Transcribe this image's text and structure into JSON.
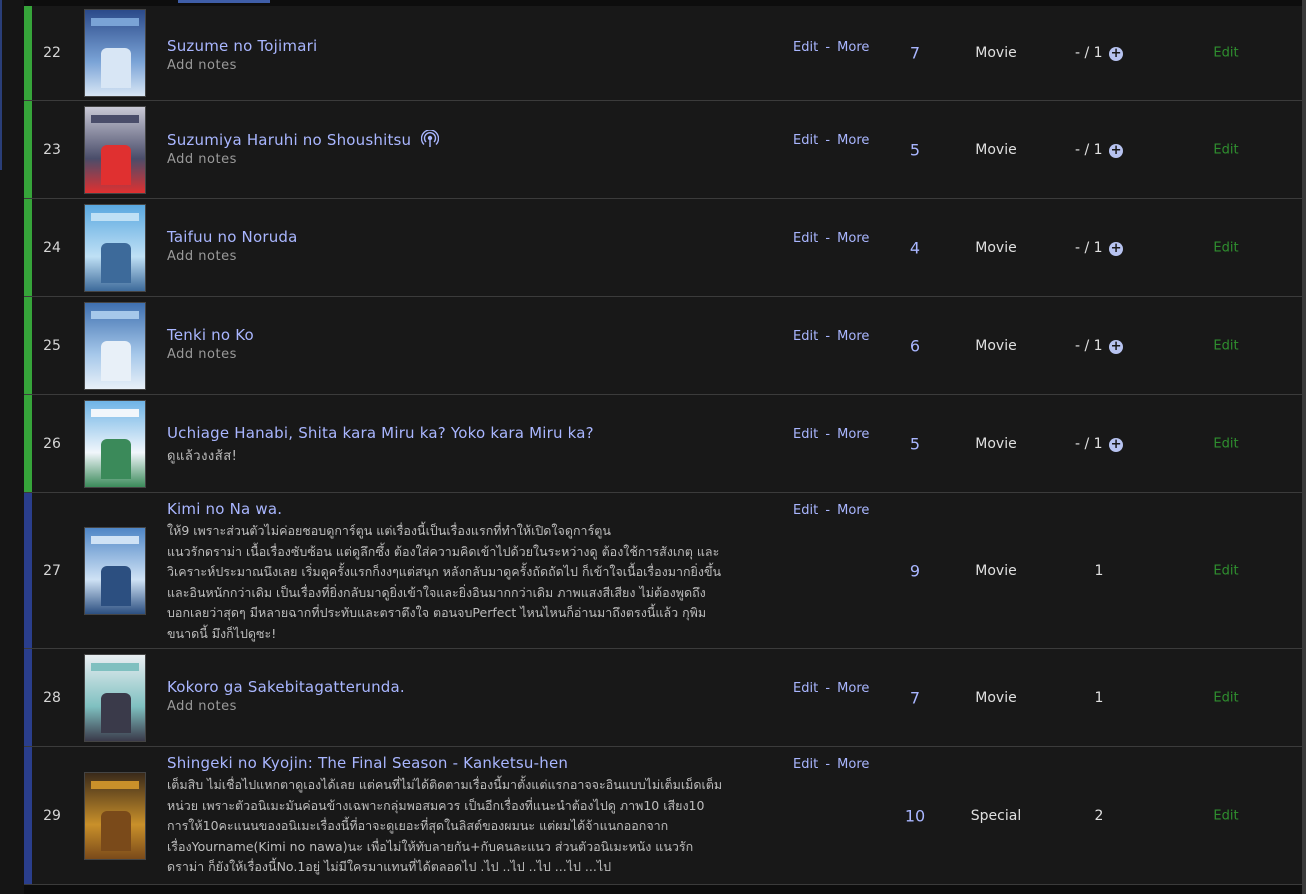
{
  "colors": {
    "completed": "#36a43a",
    "plan_to_watch": "#2a3e8c",
    "link": "#a9b6ff",
    "edit_green": "#2f8f2f"
  },
  "labels": {
    "edit": "Edit",
    "more": "More",
    "separator": "-",
    "add_notes": "Add notes",
    "edit_row": "Edit"
  },
  "rows": [
    {
      "num": "22",
      "title": "Suzume no Tojimari",
      "notes": "Add notes",
      "review": "",
      "score": "7",
      "type": "Movie",
      "progress": "- / 1",
      "has_plus": true,
      "status": "completed",
      "dub_icon": false,
      "poster": [
        "#2b4a8a",
        "#7aa3d6",
        "#d8e6f5"
      ]
    },
    {
      "num": "23",
      "title": "Suzumiya Haruhi no Shoushitsu",
      "notes": "Add notes",
      "review": "",
      "score": "5",
      "type": "Movie",
      "progress": "- / 1",
      "has_plus": true,
      "status": "completed",
      "dub_icon": true,
      "poster": [
        "#c9c9d6",
        "#4a4d6a",
        "#e03030"
      ]
    },
    {
      "num": "24",
      "title": "Taifuu no Noruda",
      "notes": "Add notes",
      "review": "",
      "score": "4",
      "type": "Movie",
      "progress": "- / 1",
      "has_plus": true,
      "status": "completed",
      "dub_icon": false,
      "poster": [
        "#5aa8e0",
        "#bfe0f5",
        "#3d6a9a"
      ]
    },
    {
      "num": "25",
      "title": "Tenki no Ko",
      "notes": "Add notes",
      "review": "",
      "score": "6",
      "type": "Movie",
      "progress": "- / 1",
      "has_plus": true,
      "status": "completed",
      "dub_icon": false,
      "poster": [
        "#3f70b0",
        "#a6c8ea",
        "#e8f0f8"
      ]
    },
    {
      "num": "26",
      "title": "Uchiage Hanabi, Shita kara Miru ka? Yoko kara Miru ka?",
      "notes": "ดูแล้วงงส้ส!",
      "review": "",
      "score": "5",
      "type": "Movie",
      "progress": "- / 1",
      "has_plus": true,
      "status": "completed",
      "dub_icon": false,
      "poster": [
        "#6fb4e6",
        "#f1f6fb",
        "#3b8a5a"
      ]
    },
    {
      "num": "27",
      "title": "Kimi no Na wa.",
      "notes": "",
      "review": "ให้9 เพราะส่วนตัวไม่ค่อยชอบดูการ์ตูน แต่เรื่องนี้เป็นเรื่องแรกที่ทำให้เปิดใจดูการ์ตูน\nแนวรักดราม่า เนื้อเรื่องซับซ้อน แต่ดูลึกซึ้ง ต้องใส่ความคิดเข้าไปด้วยในระหว่างดู ต้องใช้การสังเกตุ และ\nวิเคราะห์ประมาณนึงเลย เริ่มดูครั้งแรกก็งงๆแต่สนุก หลังกลับมาดูครั้งถัดถัดไป ก็เข้าใจเนื้อเรื่องมากยิ่งขึ้น\nและอินหนักกว่าเดิม เป็นเรื่องที่ยิ่งกลับมาดูยิ่งเข้าใจและยิ่งอินมากกว่าเดิม ภาพแสงสีเสียง ไม่ต้องพูดถึง\nบอกเลยว่าสุดๆ มีหลายฉากที่ประทับและตราตึงใจ ตอนจบPerfect ไหนไหนก็อ่านมาถึงตรงนี้แล้ว กุพิม\nขนาดนี้ มึงก็ไปดูซะ!",
      "score": "9",
      "type": "Movie",
      "progress": "1",
      "has_plus": false,
      "status": "plan_to_watch",
      "dub_icon": false,
      "poster": [
        "#4f86c6",
        "#cfe2f5",
        "#2c4f80"
      ]
    },
    {
      "num": "28",
      "title": "Kokoro ga Sakebitagatterunda.",
      "notes": "Add notes",
      "review": "",
      "score": "7",
      "type": "Movie",
      "progress": "1",
      "has_plus": false,
      "status": "plan_to_watch",
      "dub_icon": false,
      "poster": [
        "#e9eef2",
        "#7fc0c0",
        "#3a3a4a"
      ]
    },
    {
      "num": "29",
      "title": "Shingeki no Kyojin: The Final Season - Kanketsu-hen",
      "notes": "",
      "review": "เต็มสิบ ไม่เชื่อไปแหกตาดูเองได้เลย แต่คนที่ไม่ได้ติดตามเรื่องนี้มาตั้งแต่แรกอาจจะอินแบบไม่เต็มเม็ดเต็ม\nหน่วย เพราะตัวอนิเมะมันค่อนข้างเฉพาะกลุ่มพอสมควร เป็นอีกเรื่องที่แนะนำต้องไปดู ภาพ10 เสียง10\nการให้10คะแนนของอนิเมะเรื่องนี้ที่อาจะดูเยอะที่สุดในลิสต์ของผมนะ แต่ผมได้จ้าแนกออกจาก\nเรื่องYourname(Kimi no nawa)นะ เพื่อไม่ให้ทับลายกัน+กับคนละแนว ส่วนตัวอนิเมะหนัง แนวรัก\nดราม่า ก็ยังให้เรื่องนี้No.1อยู่ ไม่มีใครมาแทนที่ได้ตลอดไป .ไป ..ไป ..ไป ...ไป ...ไป",
      "score": "10",
      "type": "Special",
      "progress": "2",
      "has_plus": false,
      "status": "plan_to_watch",
      "dub_icon": false,
      "poster": [
        "#3a2a1a",
        "#c9902a",
        "#7a4a1a"
      ]
    }
  ]
}
